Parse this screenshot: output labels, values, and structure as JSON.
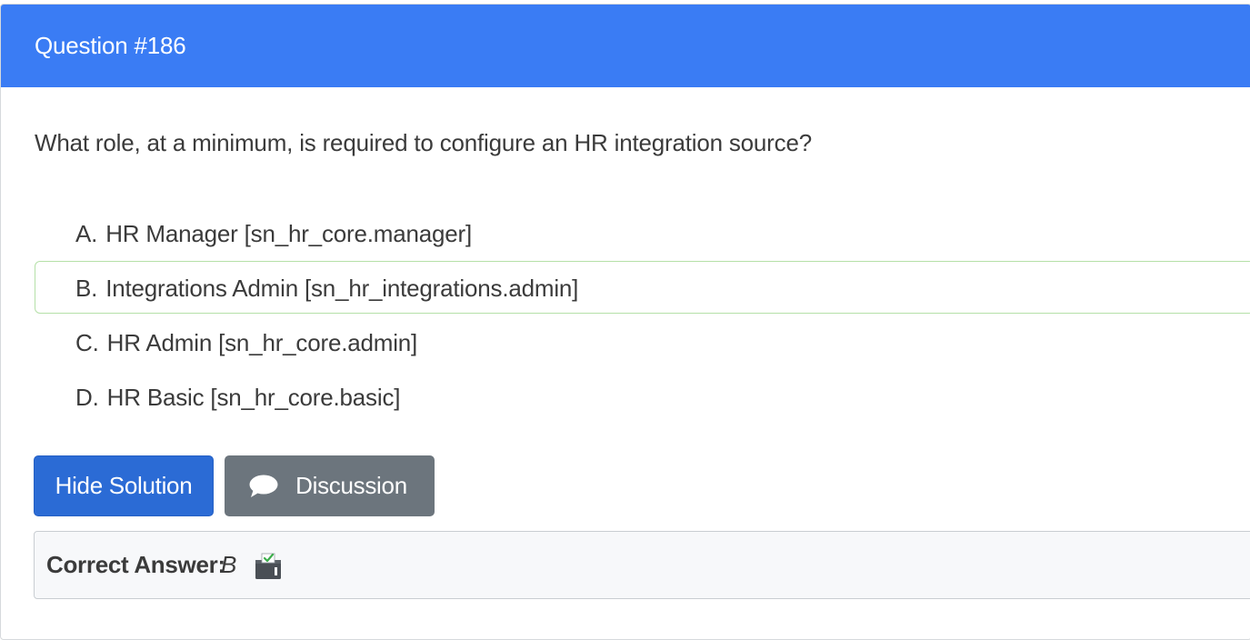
{
  "question": {
    "title": "Question #186",
    "text": "What role, at a minimum, is required to configure an HR integration source?"
  },
  "choices": [
    {
      "letter": "A.",
      "text": "HR Manager [sn_hr_core.manager]",
      "correct": false
    },
    {
      "letter": "B.",
      "text": "Integrations Admin [sn_hr_integrations.admin]",
      "correct": true
    },
    {
      "letter": "C.",
      "text": "HR Admin [sn_hr_core.admin]",
      "correct": false
    },
    {
      "letter": "D.",
      "text": "HR Basic [sn_hr_core.basic]",
      "correct": false
    }
  ],
  "buttons": {
    "hide_solution": "Hide Solution",
    "discussion": "Discussion",
    "discussion_icon": "chat-bubble-icon"
  },
  "answer": {
    "label": "Correct Answer:",
    "value": "B",
    "icon": "vote-box-icon"
  },
  "colors": {
    "header": "#3a7cf4",
    "primary_button": "#2b6bd5",
    "secondary_button": "#6c757d",
    "correct_border": "#b5e0a8"
  }
}
